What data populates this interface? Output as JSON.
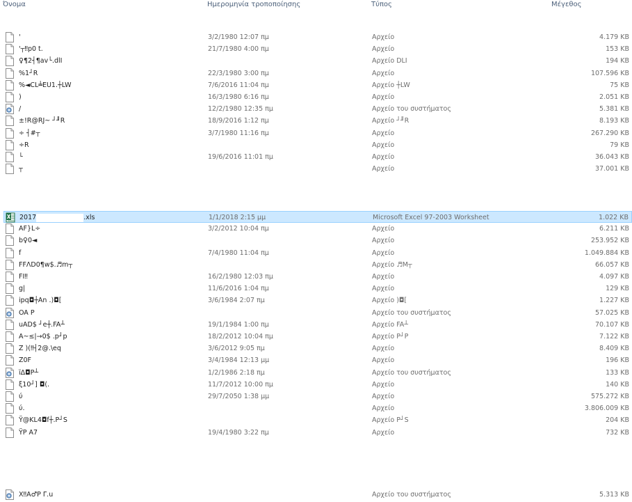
{
  "columns": {
    "name": "Όνομα",
    "date": "Ημερομηνία τροποποίησης",
    "type": "Τύπος",
    "size": "Μέγεθος"
  },
  "groups": [
    {
      "rows": [
        {
          "icon": "file-icon",
          "name": "'",
          "date": "3/2/1980 12:07 πμ",
          "type": "Αρχείο",
          "size": "4.179 KB"
        },
        {
          "icon": "file-icon",
          "name": "'┬‼p0 t.",
          "date": "21/7/1980 4:00 πμ",
          "type": "Αρχείο",
          "size": "153 KB"
        },
        {
          "icon": "file-icon",
          "name": "♀¶2┤¶av└.dlI",
          "date": "",
          "type": "Αρχείο DLI",
          "size": "194 KB"
        },
        {
          "icon": "file-icon",
          "name": "%1┘R",
          "date": "22/3/1980 3:00 πμ",
          "type": "Αρχείο",
          "size": "107.596 KB"
        },
        {
          "icon": "file-icon",
          "name": "%◄CL╧EU1.┼LW",
          "date": "7/6/2016 11:04 πμ",
          "type": "Αρχείο ┼LW",
          "size": "75 KB"
        },
        {
          "icon": "file-icon",
          "name": ")",
          "date": "16/3/1980 6:16 πμ",
          "type": "Αρχείο",
          "size": "2.051 KB"
        },
        {
          "icon": "system-file-icon",
          "name": "/",
          "date": "12/2/1980 12:35 πμ",
          "type": "Αρχείο του συστήματος",
          "size": "5.381 KB"
        },
        {
          "icon": "file-icon",
          "name": "±!R@RJ~  ┘╜R",
          "date": "18/9/2016 1:12 πμ",
          "type": "Αρχείο ┘╜R",
          "size": "8.193 KB"
        },
        {
          "icon": "file-icon",
          "name": "÷ ┤#┬",
          "date": "3/7/1980 11:16 πμ",
          "type": "Αρχείο",
          "size": "267.290 KB"
        },
        {
          "icon": "file-icon",
          "name": "÷R",
          "date": "",
          "type": "Αρχείο",
          "size": "79 KB"
        },
        {
          "icon": "file-icon",
          "name": "└",
          "date": "19/6/2016 11:01 πμ",
          "type": "Αρχείο",
          "size": "36.043 KB"
        },
        {
          "icon": "file-icon",
          "name": "┬",
          "date": "",
          "type": "Αρχείο",
          "size": "37.001 KB"
        }
      ]
    },
    {
      "rows": [
        {
          "icon": "excel-file-icon",
          "name_prefix": "2017",
          "name_suffix": ".xls",
          "date": "1/1/2018 2:15 μμ",
          "type": "Microsoft Excel 97-2003 Worksheet",
          "size": "1.022 KB",
          "selected": true
        },
        {
          "icon": "file-icon",
          "name": "AF}L÷",
          "date": "3/2/2012 10:04 πμ",
          "type": "Αρχείο",
          "size": "6.211 KB"
        },
        {
          "icon": "file-icon",
          "name": "b♀0◄",
          "date": "",
          "type": "Αρχείο",
          "size": "253.952 KB"
        },
        {
          "icon": "file-icon",
          "name": "f",
          "date": "7/4/1980 11:04 πμ",
          "type": "Αρχείο",
          "size": "1.049.884 KB"
        },
        {
          "icon": "file-icon",
          "name": "FFΛD0¶w$.♬m┬",
          "date": "",
          "type": "Αρχείο ♬M┬",
          "size": "66.057 KB"
        },
        {
          "icon": "file-icon",
          "name": "FI‼",
          "date": "16/2/1980 12:03 πμ",
          "type": "Αρχείο",
          "size": "4.097 KB"
        },
        {
          "icon": "file-icon",
          "name": "g|",
          "date": "11/6/2016 1:04 πμ",
          "type": "Αρχείο",
          "size": "129 KB"
        },
        {
          "icon": "file-icon",
          "name": "ipq◘┼An  .)◘[",
          "date": "3/6/1984 2:07 πμ",
          "type": "Αρχείο )◘[",
          "size": "1.227 KB"
        },
        {
          "icon": "system-file-icon",
          "name": "OA P",
          "date": "",
          "type": "Αρχείο του συστήματος",
          "size": "57.025 KB"
        },
        {
          "icon": "file-icon",
          "name": "uAD$ ┘e┼.FA┴",
          "date": "19/1/1984 1:00 πμ",
          "type": "Αρχείο FA┴",
          "size": "70.107 KB"
        },
        {
          "icon": "file-icon",
          "name": "A~≤|→0$  .p┘p",
          "date": "18/2/2012 10:04 πμ",
          "type": "Αρχείο P┘P",
          "size": "7.122 KB"
        },
        {
          "icon": "file-icon",
          "name": "Z )(‼┤2@.\\eq",
          "date": "3/6/2012 9:05 πμ",
          "type": "Αρχείο",
          "size": "8.409 KB"
        },
        {
          "icon": "file-icon",
          "name": "Z0F",
          "date": "3/4/1984 12:13 μμ",
          "type": "Αρχείο",
          "size": "196 KB"
        },
        {
          "icon": "system-file-icon",
          "name": "ïΔ◘P┴",
          "date": "1/2/1986 2:18 πμ",
          "type": "Αρχείο του συστήματος",
          "size": "133 KB"
        },
        {
          "icon": "file-icon",
          "name": "ξ10┘]  ◘(.",
          "date": "11/7/2012 10:00 πμ",
          "type": "Αρχείο",
          "size": "140 KB"
        },
        {
          "icon": "file-icon",
          "name": "ύ",
          "date": "29/7/2050 1:38 μμ",
          "type": "Αρχείο",
          "size": "575.272 KB"
        },
        {
          "icon": "file-icon",
          "name": "ύ.",
          "date": "",
          "type": "Αρχείο",
          "size": "3.806.009 KB"
        },
        {
          "icon": "file-icon",
          "name": "Ÿ@KL4◘f┼.P┘S",
          "date": "",
          "type": "Αρχείο P┘S",
          "size": "204 KB"
        },
        {
          "icon": "file-icon",
          "name": "ŸP   A7",
          "date": "19/4/1980 3:22 πμ",
          "type": "Αρχείο",
          "size": "732 KB"
        }
      ]
    },
    {
      "rows": [
        {
          "icon": "system-file-icon",
          "name": "  X‼A♂P  Γ.u",
          "date": "",
          "type": "Αρχείο του συστήματος",
          "size": "5.313 KB"
        }
      ]
    }
  ]
}
